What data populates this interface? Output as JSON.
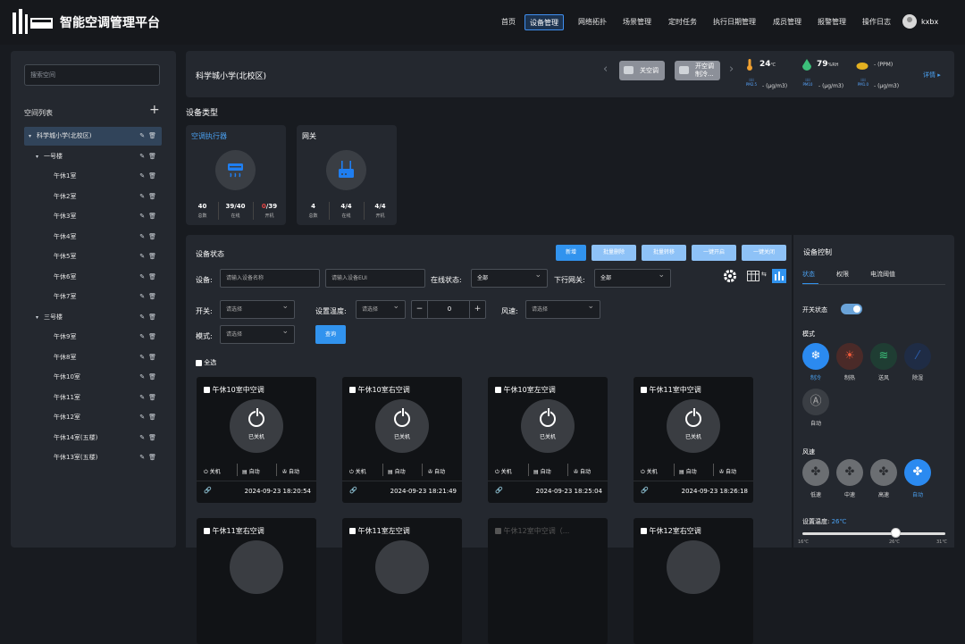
{
  "app": {
    "title": "智能空调管理平台",
    "user": "kxbx"
  },
  "nav": [
    "首页",
    "设备管理",
    "网络拓扑",
    "场景管理",
    "定时任务",
    "执行日期管理",
    "成员管理",
    "报警管理",
    "操作日志"
  ],
  "nav_active": "设备管理",
  "sidebar": {
    "search_placeholder": "搜索空间",
    "list_title": "空间列表",
    "tree": [
      {
        "label": "科学城小学(北校区)",
        "level": 0,
        "expanded": true,
        "selected": true
      },
      {
        "label": "一号楼",
        "level": 1,
        "expanded": true
      },
      {
        "label": "午休1室",
        "level": 2
      },
      {
        "label": "午休2室",
        "level": 2
      },
      {
        "label": "午休3室",
        "level": 2
      },
      {
        "label": "午休4室",
        "level": 2
      },
      {
        "label": "午休5室",
        "level": 2
      },
      {
        "label": "午休6室",
        "level": 2
      },
      {
        "label": "午休7室",
        "level": 2
      },
      {
        "label": "三号楼",
        "level": 1,
        "expanded": true
      },
      {
        "label": "午休9室",
        "level": 2
      },
      {
        "label": "午休8室",
        "level": 2
      },
      {
        "label": "午休10室",
        "level": 2
      },
      {
        "label": "午休11室",
        "level": 2
      },
      {
        "label": "午休12室",
        "level": 2
      },
      {
        "label": "午休14室(五楼)",
        "level": 2
      },
      {
        "label": "午休13室(五楼)",
        "level": 2
      }
    ]
  },
  "location": {
    "name": "科学城小学(北校区)",
    "presets": [
      {
        "label": "关空调"
      },
      {
        "label_1": "开空调",
        "label_2": "制冷..."
      }
    ],
    "temperature": "24",
    "temperature_unit": "℃",
    "humidity": "79",
    "humidity_unit": "%RH",
    "co2": "-",
    "co2_unit": "(PPM)",
    "pm25": "-",
    "pm25_unit": "(μg/m3)",
    "pm25_label": "PM2.5",
    "pm10": "-",
    "pm10_unit": "(μg/m3)",
    "pm10_label": "PM10",
    "pm1": "-",
    "pm1_unit": "(μg/m3)",
    "pm1_label": "PM1.0",
    "detail": "详情 ▸"
  },
  "device_types": {
    "title": "设备类型",
    "items": [
      {
        "name": "空调执行器",
        "active": true,
        "stats": [
          {
            "v": "40",
            "l": "总数"
          },
          {
            "v": "39/40",
            "l": "在线"
          },
          {
            "v_warn": "0",
            "v": "/39",
            "l": "开机"
          }
        ]
      },
      {
        "name": "网关",
        "active": false,
        "stats": [
          {
            "v": "4",
            "l": "总数"
          },
          {
            "v": "4/4",
            "l": "在线"
          },
          {
            "v": "4/4",
            "l": "开机"
          }
        ]
      }
    ]
  },
  "status": {
    "title": "设备状态",
    "actions": [
      "新增",
      "批量删除",
      "批量转移",
      "一键开启",
      "一键关闭"
    ],
    "filters": {
      "device_label": "设备:",
      "device_placeholder": "请输入设备名称",
      "eui_placeholder": "请输入设备EUI",
      "online_label": "在线状态:",
      "online_value": "全部",
      "gateway_label": "下行网关:",
      "gateway_value": "全部",
      "switch_label": "开关:",
      "switch_placeholder": "请选择",
      "settemp_label": "设置温度:",
      "settemp_placeholder": "请选择",
      "settemp_value": "0",
      "wind_label": "风速:",
      "wind_placeholder": "请选择",
      "mode_label": "模式:",
      "mode_placeholder": "请选择",
      "query": "查询",
      "select_all": "全选"
    },
    "cards": [
      {
        "name": "午休10室中空调",
        "state": "已关机",
        "power": "关机",
        "mode": "自动",
        "fan": "自动",
        "time": "2024-09-23 18:20:54"
      },
      {
        "name": "午休10室右空调",
        "state": "已关机",
        "power": "关机",
        "mode": "自动",
        "fan": "自动",
        "time": "2024-09-23 18:21:49"
      },
      {
        "name": "午休10室左空调",
        "state": "已关机",
        "power": "关机",
        "mode": "自动",
        "fan": "自动",
        "time": "2024-09-23 18:25:04"
      },
      {
        "name": "午休11室中空调",
        "state": "已关机",
        "power": "关机",
        "mode": "自动",
        "fan": "自动",
        "time": "2024-09-23 18:26:18"
      },
      {
        "name": "午休11室右空调"
      },
      {
        "name": "午休11室左空调"
      },
      {
        "name": "午休12室中空调（...",
        "disabled": true
      },
      {
        "name": "午休12室右空调"
      }
    ]
  },
  "control": {
    "title": "设备控制",
    "tabs": [
      "状态",
      "权限",
      "电流阈值"
    ],
    "switch_label": "开关状态",
    "mode_label": "模式",
    "modes": [
      {
        "label": "制冷",
        "icon": "snowflake-icon",
        "active": true
      },
      {
        "label": "制热",
        "icon": "sun-icon"
      },
      {
        "label": "送风",
        "icon": "wind-icon"
      },
      {
        "label": "除湿",
        "icon": "drop-icon"
      },
      {
        "label": "自动",
        "icon": "auto-icon"
      }
    ],
    "fan_label": "风速",
    "fans": [
      {
        "label": "低速"
      },
      {
        "label": "中速"
      },
      {
        "label": "高速"
      },
      {
        "label": "自动",
        "active": true
      }
    ],
    "temp_label": "设置温度:",
    "temp_value": "26℃",
    "temp_level": 26,
    "temp_min": "16℃",
    "temp_mid": "26℃",
    "temp_max": "31℃"
  },
  "colors": {
    "accent": "#3193ee",
    "warn": "#e84545",
    "cool": "#2b8af0"
  }
}
